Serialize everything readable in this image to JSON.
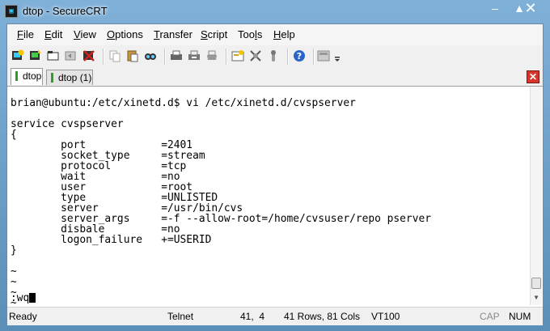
{
  "window": {
    "title": "dtop - SecureCRT",
    "app_icon_glyph": "▣",
    "minimize": "–",
    "maximize": "▲",
    "close": "✕"
  },
  "menu": [
    {
      "accel": "F",
      "rest": "ile"
    },
    {
      "accel": "E",
      "rest": "dit"
    },
    {
      "accel": "V",
      "rest": "iew"
    },
    {
      "accel": "O",
      "rest": "ptions"
    },
    {
      "accel": "T",
      "rest": "ransfer"
    },
    {
      "accel": "S",
      "rest": "cript"
    },
    {
      "pre": "Too",
      "accel": "l",
      "rest": "s"
    },
    {
      "accel": "H",
      "rest": "elp"
    }
  ],
  "toolbar": {
    "icons": [
      "connect-icon",
      "quick-connect-icon",
      "connect-tab-icon",
      "reconnect-icon",
      "disconnect-icon",
      "copy-icon",
      "paste-icon",
      "find-icon",
      "print-icon",
      "print-selection-icon",
      "print-screen-icon",
      "session-options-icon",
      "global-options-icon",
      "keymap-icon",
      "help-icon",
      "sftp-icon",
      "more-icon"
    ],
    "colors": {
      "accent": "#2b64c8",
      "warn": "#d0a020",
      "stop": "#c02020"
    }
  },
  "tabs": [
    {
      "label": "dtop",
      "active": true
    },
    {
      "label": "dtop (1)",
      "active": false
    }
  ],
  "tab_close_glyph": "✕",
  "terminal": {
    "lines": [
      "",
      "brian@ubuntu:/etc/xinetd.d$ vi /etc/xinetd.d/cvspserver",
      "",
      "service cvspserver",
      "{",
      "        port            =2401",
      "        socket_type     =stream",
      "        protocol        =tcp",
      "        wait            =no",
      "        user            =root",
      "        type            =UNLISTED",
      "        server          =/usr/bin/cvs",
      "        server_args     =-f --allow-root=/home/cvsuser/repo pserver",
      "        disbale         =no",
      "        logon_failure   +=USERID",
      "}",
      "",
      "~",
      "~",
      "~",
      "~"
    ],
    "command_line": ":wq"
  },
  "status": {
    "ready": "Ready",
    "protocol": "Telnet",
    "position": "41,  4",
    "size": "41 Rows, 81 Cols",
    "emulation": "VT100",
    "cap": "CAP",
    "num": "NUM"
  }
}
